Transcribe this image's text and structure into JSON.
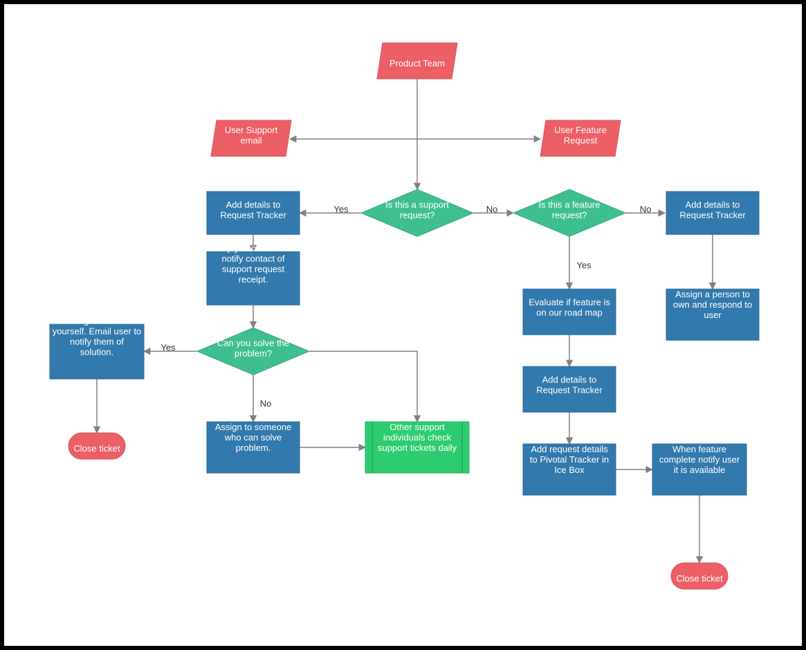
{
  "nodes": {
    "product_team": {
      "label": "Product Team"
    },
    "user_support_email": {
      "label": "User Support\nemail"
    },
    "user_feature_request": {
      "label": "User Feature\nRequest"
    },
    "is_support_request": {
      "label": "Is this a support\nrequest?"
    },
    "is_feature_request": {
      "label": "Is this a feature\nrequest?"
    },
    "add_details_left": {
      "label": "Add details to\nRequest Tracker"
    },
    "add_details_right": {
      "label": "Add details to\nRequest Tracker"
    },
    "reply_contact": {
      "label": "Reply to contact to\nnotify contact of\nsupport request\nreceipt."
    },
    "can_solve": {
      "label": "Can you solve the\nproblem?"
    },
    "assign_self": {
      "label": "Assign ticket to\nyourself. Email user to\nnotify them of\nsolution."
    },
    "close_ticket_left": {
      "label": "Close ticket"
    },
    "assign_someone": {
      "label": "Assign to someone\nwho can solve\nproblem."
    },
    "other_support": {
      "label": "Other support\nindividuals check\nsupport tickets daily"
    },
    "evaluate_roadmap": {
      "label": "Evaluate if feature is\non our road map"
    },
    "add_details_mid": {
      "label": "Add details to\nRequest Tracker"
    },
    "add_pivotal": {
      "label": "Add request details\nto Pivotal Tracker in\nIce Box"
    },
    "notify_available": {
      "label": "When feature\ncomplete notify user\nit is available"
    },
    "assign_person": {
      "label": "Assign a person to\nown and respond to\nuser"
    },
    "close_ticket_right": {
      "label": "Close ticket"
    }
  },
  "edge_labels": {
    "yes1": "Yes",
    "no1": "No",
    "yes2": "Yes",
    "no2": "No",
    "yes3": "Yes",
    "no3": "No"
  },
  "colors": {
    "process": "#3279ad",
    "decision": "#3fbf8f",
    "start": "#ec5f67",
    "terminator": "#ec5f67",
    "subprocess": "#2ecc71",
    "edge": "#808080"
  }
}
